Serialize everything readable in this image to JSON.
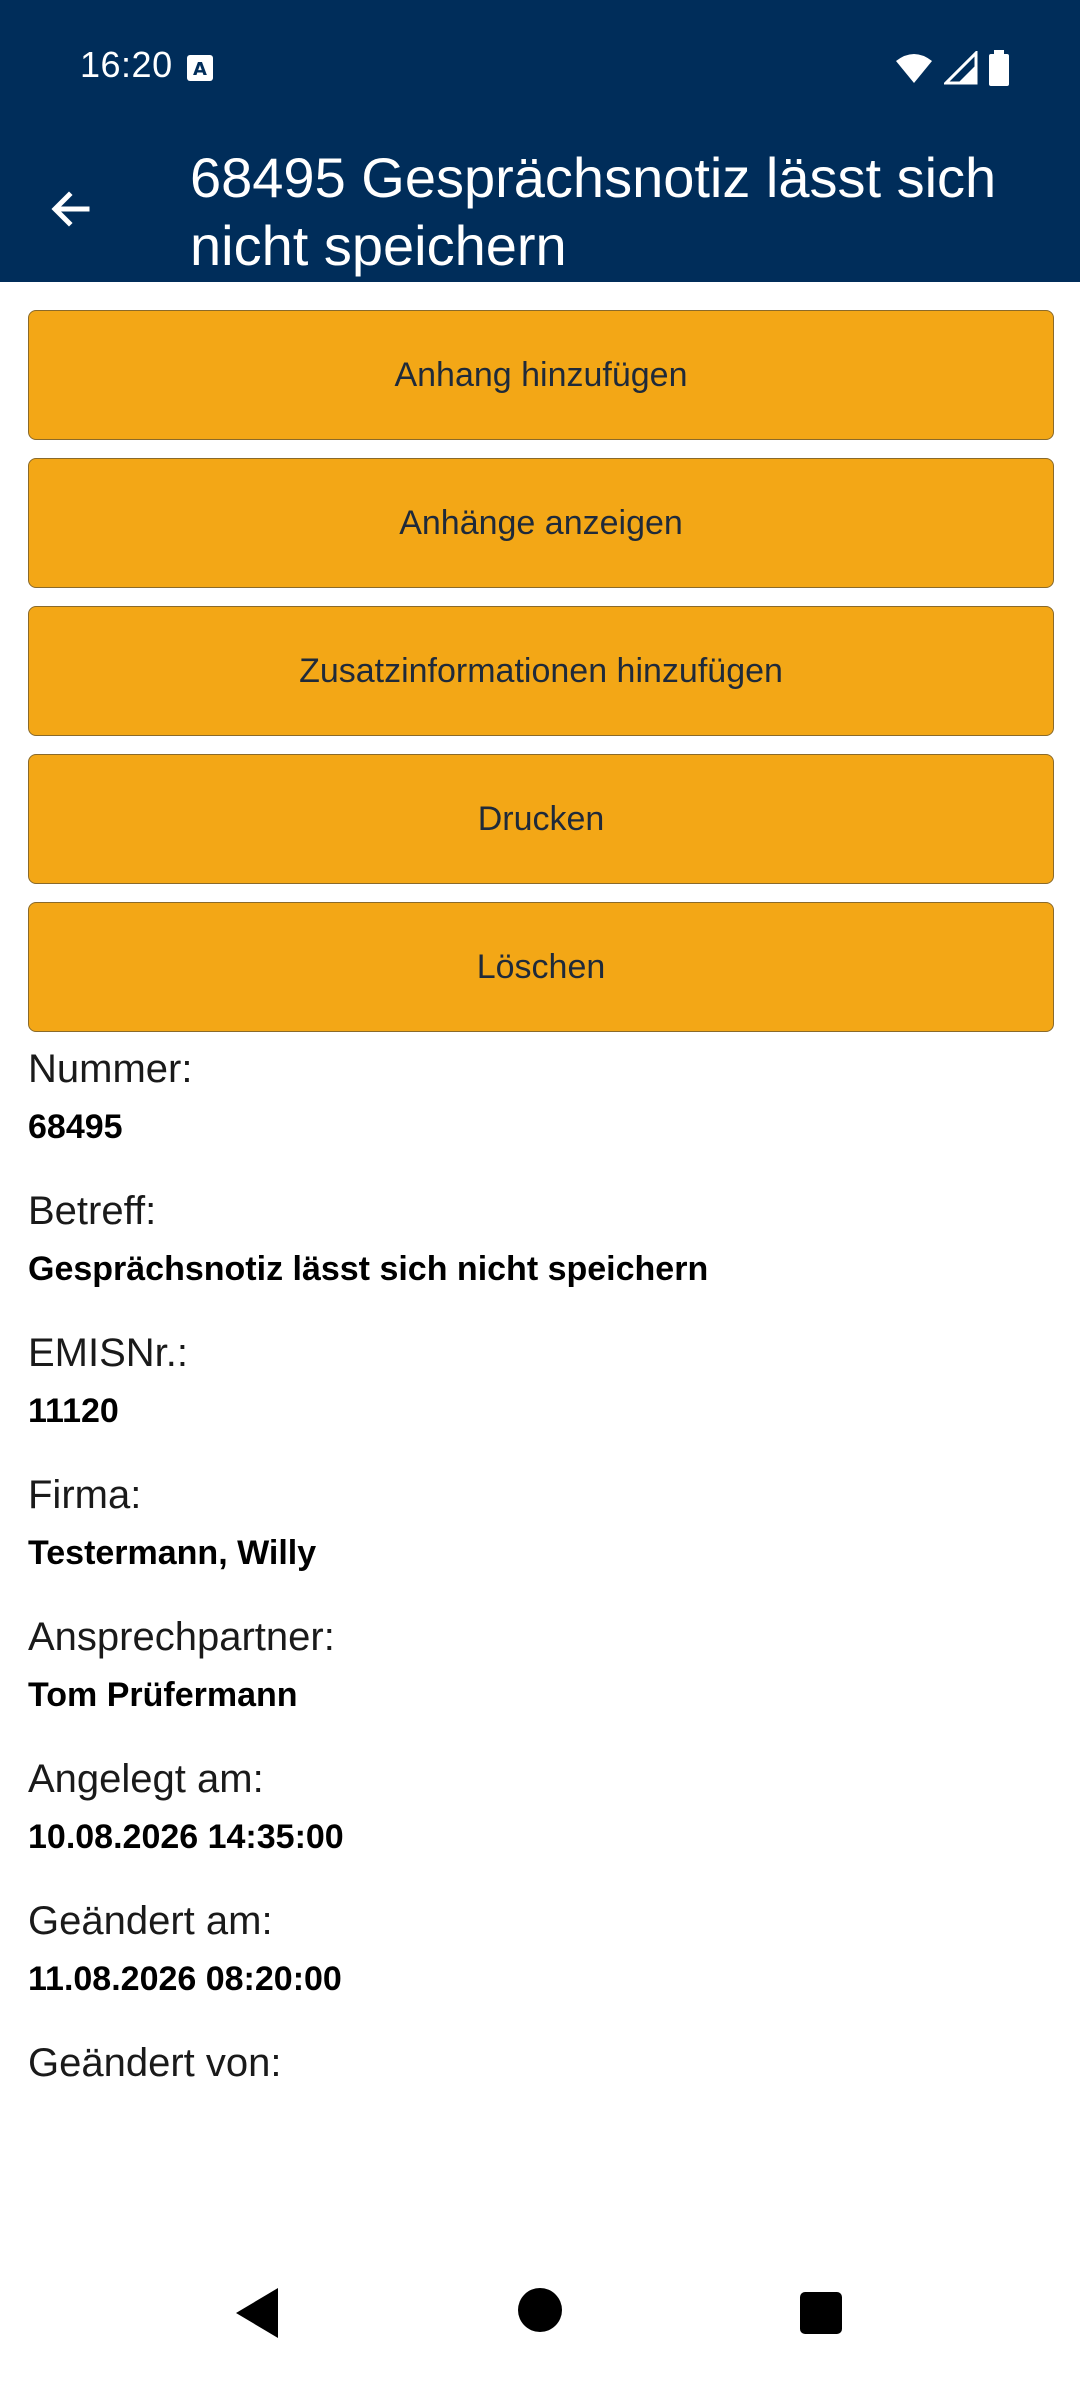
{
  "status": {
    "time": "16:20"
  },
  "appbar": {
    "title": "68495 Gesprächsnotiz lässt sich nicht speichern"
  },
  "actions": {
    "add_attachment": "Anhang hinzufügen",
    "show_attachments": "Anhänge anzeigen",
    "add_extra_info": "Zusatzinformationen hinzufügen",
    "print": "Drucken",
    "delete": "Löschen"
  },
  "details": {
    "nummer": {
      "label": "Nummer:",
      "value": "68495"
    },
    "betreff": {
      "label": "Betreff:",
      "value": "Gesprächsnotiz lässt sich nicht speichern"
    },
    "emisnr": {
      "label": "EMISNr.:",
      "value": "11120"
    },
    "firma": {
      "label": "Firma:",
      "value": "Testermann, Willy"
    },
    "ansprechpartner": {
      "label": "Ansprechpartner:",
      "value": "Tom Prüfermann"
    },
    "angelegt": {
      "label": "Angelegt am:",
      "value": "10.08.2026 14:35:00"
    },
    "geaendert": {
      "label": "Geändert am:",
      "value": "11.08.2026 08:20:00"
    },
    "geaendert_von": {
      "label": "Geändert von:",
      "value": ""
    }
  },
  "colors": {
    "header": "#002d5a",
    "button": "#f3a716"
  }
}
